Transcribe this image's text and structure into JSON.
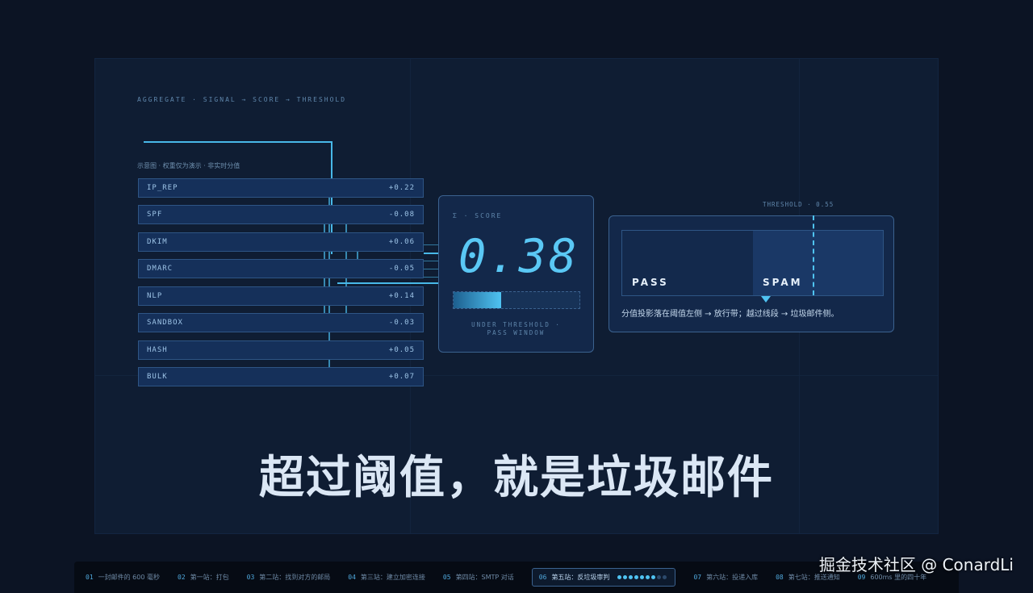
{
  "pipeline_label": "AGGREGATE · SIGNAL → SCORE → THRESHOLD",
  "note": "示意图 · 权重仅为演示 · 非实时分值",
  "signals": [
    {
      "name": "IP_REP",
      "value": "+0.22"
    },
    {
      "name": "SPF",
      "value": "-0.08"
    },
    {
      "name": "DKIM",
      "value": "+0.06"
    },
    {
      "name": "DMARC",
      "value": "-0.05"
    },
    {
      "name": "NLP",
      "value": "+0.14"
    },
    {
      "name": "SANDBOX",
      "value": "-0.03"
    },
    {
      "name": "HASH",
      "value": "+0.05"
    },
    {
      "name": "BULK",
      "value": "+0.07"
    }
  ],
  "score": {
    "label": "Σ · SCORE",
    "value": "0.38",
    "fill": 0.38,
    "caption_line1": "UNDER THRESHOLD ·",
    "caption_line2": "PASS WINDOW"
  },
  "threshold": {
    "label": "THRESHOLD · 0.55",
    "pass_label": "PASS",
    "spam_label": "SPAM",
    "caption": "分值投影落在阈值左侧 → 放行带；越过线段 → 垃圾邮件侧。"
  },
  "headline": "超过阈值，就是垃圾邮件",
  "nav": [
    {
      "num": "01",
      "label": "一封邮件的 600 毫秒"
    },
    {
      "num": "02",
      "label": "第一站：打包"
    },
    {
      "num": "03",
      "label": "第二站：找到对方的邮局"
    },
    {
      "num": "04",
      "label": "第三站：建立加密连接"
    },
    {
      "num": "05",
      "label": "第四站：SMTP 对话"
    },
    {
      "num": "06",
      "label": "第五站：反垃圾审判",
      "active": true
    },
    {
      "num": "07",
      "label": "第六站：投递入库"
    },
    {
      "num": "08",
      "label": "第七站：推送通知"
    },
    {
      "num": "09",
      "label": "600ms 里的四十年"
    }
  ],
  "progress_dots": {
    "filled": 7,
    "total": 9
  },
  "watermark": "掘金技术社区 @ ConardLi",
  "colors": {
    "accent": "#4fc3f2",
    "background": "#0c1424",
    "panel": "#13284a"
  }
}
